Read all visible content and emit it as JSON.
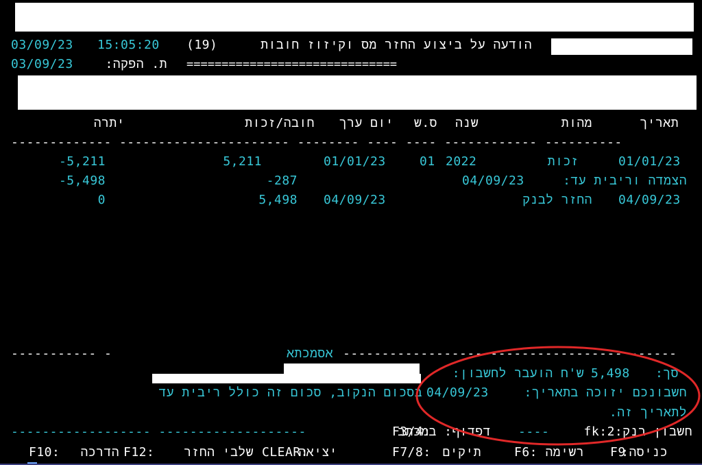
{
  "header": {
    "date": "03/09/23",
    "time": "15:05:20",
    "screen_code": "(19)",
    "title": "הודעה על ביצוע החזר מס וקיזוז חובות",
    "print_date_label": "ת. הפקה:",
    "print_date": "03/09/23",
    "underline": "=============================="
  },
  "table": {
    "columns": {
      "date": "תאריך",
      "nature": "מהות",
      "year": "שנה",
      "ss": "ס.ש",
      "value_day": "יום ערך",
      "debit_credit": "חובה/זכות",
      "balance": "יתרה"
    },
    "separator_line": "------------- ---------------------- -------- ---- ---- ------------ ----------",
    "rows": [
      {
        "date": "01/01/23",
        "nature": "זכות",
        "year": "2022",
        "ss": "01",
        "value_day": "01/01/23",
        "amount": "5,211",
        "balance": "-5,211"
      },
      {
        "combined": "הצמדה וריבית עד:",
        "combined_date": "04/09/23",
        "amount": "-287",
        "balance": "-5,498"
      },
      {
        "date": "04/09/23",
        "nature": "החזר לבנק",
        "value_day": "04/09/23",
        "amount": "5,498",
        "balance": "0"
      }
    ]
  },
  "reference": {
    "label": "אסמכתא",
    "line_right": "------------------------------------ ------",
    "line_left": "----------- -"
  },
  "summary": {
    "total_label": "סך:",
    "total_amount": "5,498",
    "transfer_text": "ש'ח הועבר לחשבון:",
    "line2_a": "חשבונכם יזוכה בתאריך:",
    "line2_date": "04/09/23",
    "line2_b": "בסכום הנקוב, סכום זה כולל ריבית עד",
    "line3": "לתאריך זה."
  },
  "bank_line": {
    "label": "חשבון בנק:2:fk",
    "dashes": "----",
    "exit_label": "דפדוף: במכתב",
    "key": "F3/4:",
    "left_dashes": "------------------ -------------------"
  },
  "fkeys": [
    {
      "key": "F9",
      "label": "כניסה:"
    },
    {
      "key": "F6:",
      "label": "רשימה"
    },
    {
      "key": "F7/8:",
      "label": "תיקים"
    },
    {
      "key": "CLEAR:",
      "label": "יציאה"
    },
    {
      "key": "F12:",
      "label": "שלבי החזר"
    },
    {
      "key": "F10:",
      "label": "הדרכה"
    }
  ],
  "colors": {
    "background": "#000000",
    "cyan": "#38c8d8",
    "white": "#ffffff",
    "highlight": "#e02828"
  }
}
